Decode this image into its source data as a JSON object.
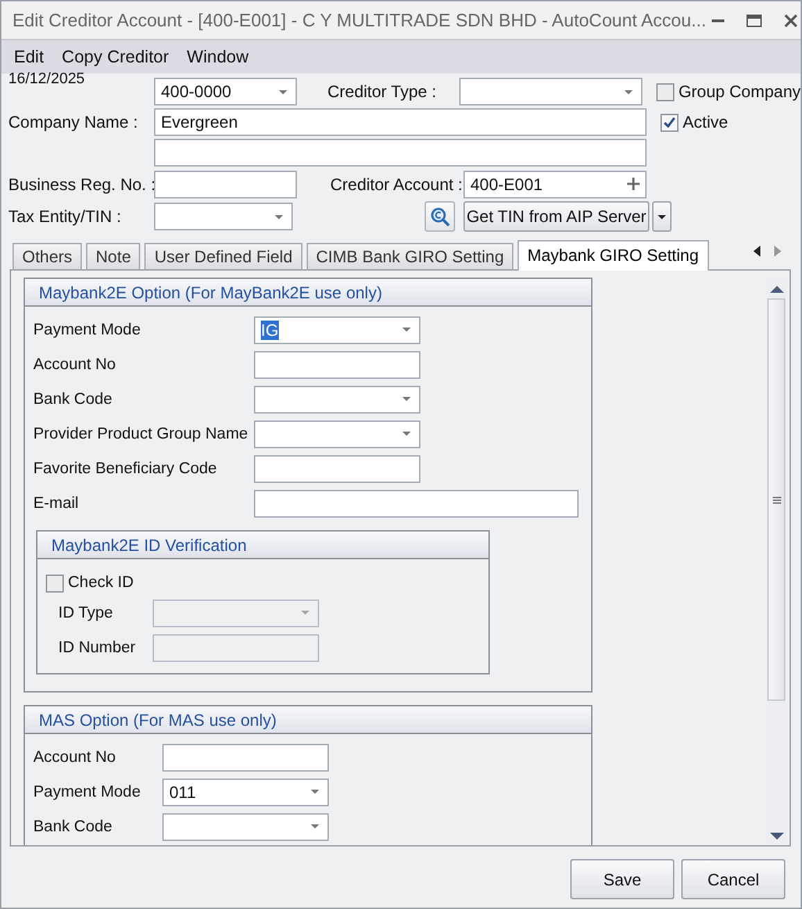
{
  "window": {
    "title": "Edit Creditor Account - [400-E001] - C Y MULTITRADE SDN BHD - AutoCount Accou..."
  },
  "menu": [
    "Edit",
    "Copy Creditor",
    "Window"
  ],
  "header": {
    "date": "16/12/2025",
    "control_account": {
      "value": "400-0000"
    },
    "creditor_type": {
      "label": "Creditor Type :"
    },
    "group_company": {
      "label": "Group Company",
      "checked": false
    },
    "company_name": {
      "label": "Company Name :",
      "value": "Evergreen"
    },
    "active": {
      "label": "Active",
      "checked": true
    },
    "business_reg_no": {
      "label": "Business Reg. No. :"
    },
    "creditor_account": {
      "label": "Creditor Account :",
      "value": "400-E001"
    },
    "tax_entity": {
      "label": "Tax Entity/TIN  :"
    },
    "get_tin_button": "Get TIN from AIP Server"
  },
  "tabs": [
    {
      "label": "Others",
      "selected": false
    },
    {
      "label": "Note",
      "selected": false
    },
    {
      "label": "User Defined Field",
      "selected": false
    },
    {
      "label": "CIMB Bank GIRO Setting",
      "selected": false
    },
    {
      "label": "Maybank GIRO Setting",
      "selected": true
    }
  ],
  "maybank2e": {
    "title": "Maybank2E Option (For MayBank2E use only)",
    "fields": [
      {
        "label": "Payment Mode",
        "kind": "combo",
        "value": "IG",
        "value_selected": true
      },
      {
        "label": "Account No",
        "kind": "text"
      },
      {
        "label": "Bank Code",
        "kind": "combo"
      },
      {
        "label": "Provider Product Group Name",
        "kind": "combo"
      },
      {
        "label": "Favorite Beneficiary Code",
        "kind": "text"
      },
      {
        "label": "E-mail",
        "kind": "wide"
      }
    ],
    "id_verification": {
      "title": "Maybank2E ID Verification",
      "check_id": {
        "label": "Check ID",
        "checked": false
      },
      "fields": [
        {
          "label": "ID Type",
          "kind": "combo",
          "disabled": true
        },
        {
          "label": "ID Number",
          "kind": "text",
          "disabled": true
        }
      ]
    }
  },
  "mas": {
    "title": "MAS Option (For MAS use only)",
    "fields": [
      {
        "label": "Account No",
        "kind": "text"
      },
      {
        "label": "Payment Mode",
        "kind": "combo",
        "value": "011"
      },
      {
        "label": "Bank Code",
        "kind": "combo"
      }
    ]
  },
  "buttons": [
    "Save",
    "Cancel"
  ]
}
